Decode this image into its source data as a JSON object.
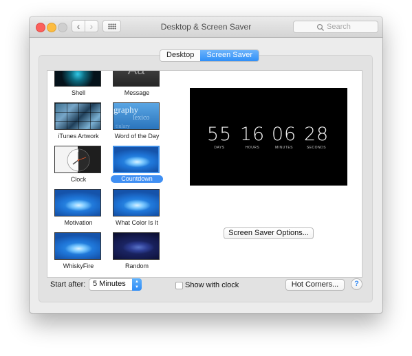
{
  "window": {
    "title": "Desktop & Screen Saver",
    "nav_back_glyph": "‹",
    "nav_forward_glyph": "›",
    "search": {
      "placeholder": "Search"
    }
  },
  "tabs": [
    {
      "label": "Desktop",
      "active": false
    },
    {
      "label": "Screen Saver",
      "active": true
    }
  ],
  "screen_savers": [
    {
      "label": "Shell",
      "icon": "shell-thumbnail",
      "selected": false
    },
    {
      "label": "Message",
      "icon": "message-thumbnail",
      "thumb_text": "Aa",
      "selected": false
    },
    {
      "label": "iTunes Artwork",
      "icon": "itunes-artwork-thumbnail",
      "selected": false
    },
    {
      "label": "Word of the Day",
      "icon": "word-of-the-day-thumbnail",
      "thumb_words": [
        "graphy",
        "lexico",
        "tiulary"
      ],
      "selected": false
    },
    {
      "label": "Clock",
      "icon": "clock-thumbnail",
      "selected": false
    },
    {
      "label": "Countdown",
      "icon": "countdown-thumbnail",
      "selected": true
    },
    {
      "label": "Motivation",
      "icon": "motivation-thumbnail",
      "selected": false
    },
    {
      "label": "What Color Is It",
      "icon": "what-color-is-it-thumbnail",
      "selected": false
    },
    {
      "label": "WhiskyFire",
      "icon": "whiskyfire-thumbnail",
      "selected": false
    },
    {
      "label": "Random",
      "icon": "random-thumbnail",
      "selected": false
    }
  ],
  "preview": {
    "countdown": [
      {
        "value": "55",
        "caption": "DAYS"
      },
      {
        "value": "16",
        "caption": "HOURS"
      },
      {
        "value": "06",
        "caption": "MINUTES"
      },
      {
        "value": "28",
        "caption": "SECONDS"
      }
    ],
    "options_button": "Screen Saver Options..."
  },
  "bottom": {
    "start_after_label": "Start after:",
    "start_after_value": "5 Minutes",
    "show_with_clock_label": "Show with clock",
    "show_with_clock_checked": false,
    "hot_corners_button": "Hot Corners...",
    "help_glyph": "?"
  },
  "colors": {
    "accent": "#3f8ff3",
    "close": "#fc605c",
    "minimize": "#fdbc40",
    "zoom_disabled": "#cfcfcf"
  }
}
